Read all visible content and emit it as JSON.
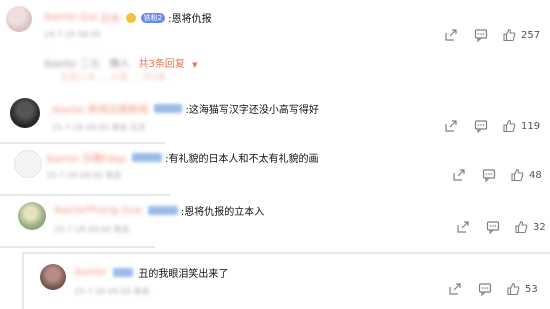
{
  "comments": [
    {
      "text": ":恩将仇报",
      "fan_badge": "铁粉2",
      "likes": "257",
      "replies_label": "共3条回复",
      "chevron": "▼"
    },
    {
      "text": ":这海猫写汉字还没小高写得好",
      "likes": "119"
    },
    {
      "text": ":有礼貌的日本人和不太有礼貌的画",
      "likes": "48"
    },
    {
      "text": ":恩将仇报的立本入",
      "likes": "32"
    },
    {
      "text": "丑的我眼泪笑出来了",
      "likes": "53"
    }
  ],
  "colors": {
    "accent": "#eb7350",
    "link_blue": "#3b7fd6",
    "icon": "#808080"
  },
  "icons": [
    "share-icon",
    "comment-icon",
    "like-icon"
  ]
}
